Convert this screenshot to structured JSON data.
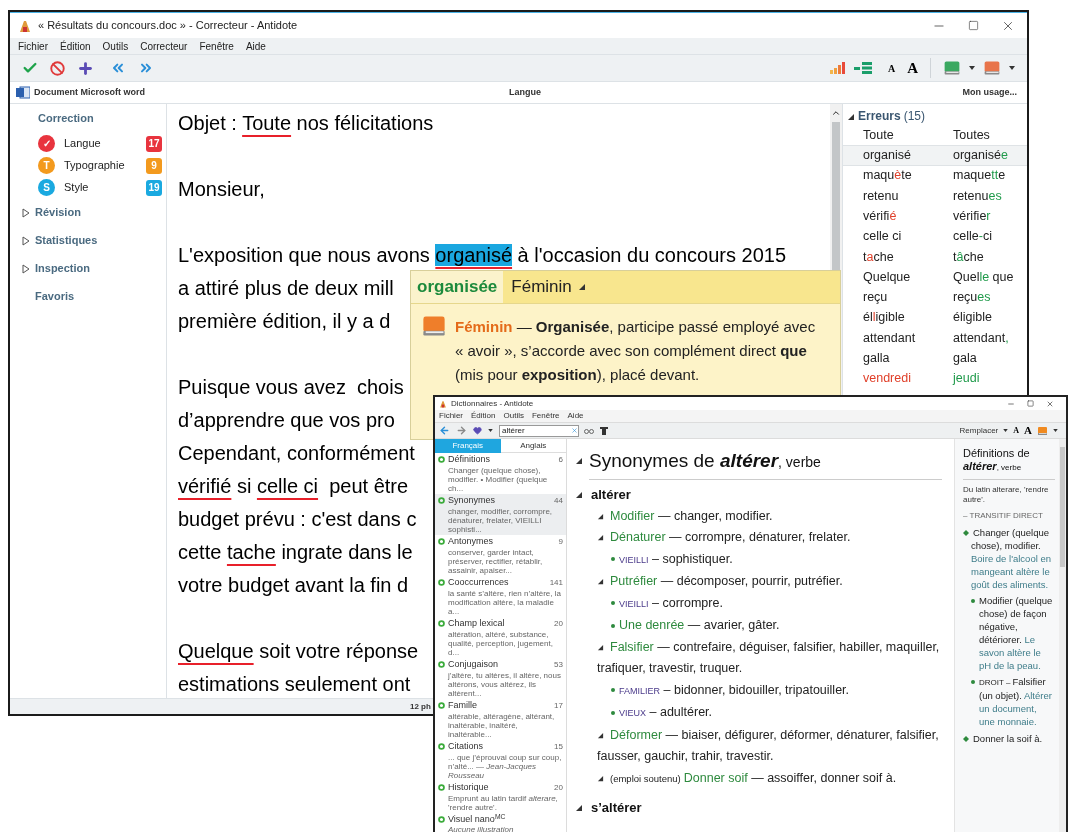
{
  "main_window": {
    "title": "« Résultats du concours.doc » - Correcteur - Antidote",
    "menu": [
      "Fichier",
      "Édition",
      "Outils",
      "Correcteur",
      "Fenêtre",
      "Aide"
    ],
    "toolbar_text": [
      "A",
      "A"
    ],
    "document_bar": {
      "source": "Document Microsoft word",
      "section": "Langue",
      "usage": "Mon usage..."
    },
    "sidebar": {
      "heading": "Correction",
      "filters": [
        {
          "label": "Langue",
          "count": "17",
          "color": "#e8343e",
          "symbol": "✓"
        },
        {
          "label": "Typographie",
          "count": "9",
          "color": "#f39a1e",
          "symbol": "T"
        },
        {
          "label": "Style",
          "count": "19",
          "color": "#1aa9e0",
          "symbol": "S"
        }
      ],
      "sections": [
        {
          "label": "Révision",
          "kind": "collapsible",
          "expanded": false
        },
        {
          "label": "Statistiques",
          "kind": "collapsible",
          "expanded": false
        },
        {
          "label": "Inspection",
          "kind": "collapsible",
          "expanded": false
        },
        {
          "label": "Favoris",
          "kind": "plain"
        }
      ]
    },
    "document": [
      [
        [
          {
            "text": "Objet : "
          },
          {
            "text": "Toute",
            "kind": "error"
          },
          {
            "text": " nos félicitations"
          }
        ]
      ],
      [
        [
          {
            "text": "Monsieur,"
          }
        ]
      ],
      [
        [
          {
            "text": "L'exposition que nous avons "
          },
          {
            "text": "organisé",
            "kind": "selected_error"
          },
          {
            "text": " à l'occasion du concours 2015"
          }
        ],
        [
          {
            "text": "a attiré plus de deux mill"
          }
        ],
        [
          {
            "text": "première édition, il y a d"
          }
        ]
      ],
      [
        [
          {
            "text": "Puisque vous avez  chois"
          }
        ],
        [
          {
            "text": "d’apprendre que vos pro"
          }
        ],
        [
          {
            "text": "Cependant, conformément"
          }
        ],
        [
          {
            "text": "vérifié",
            "kind": "error"
          },
          {
            "text": " si "
          },
          {
            "text": "celle ci",
            "kind": "error"
          },
          {
            "text": "  peut être"
          }
        ],
        [
          {
            "text": "budget prévu : c'est dans c"
          }
        ],
        [
          {
            "text": "cette "
          },
          {
            "text": "tache",
            "kind": "error"
          },
          {
            "text": " ingrate dans le"
          }
        ],
        [
          {
            "text": "votre budget avant la fin d"
          }
        ]
      ],
      [
        [
          {
            "text": "Quelque",
            "kind": "error"
          },
          {
            "text": " soit votre réponse"
          }
        ],
        [
          {
            "text": "estimations seulement ont"
          }
        ]
      ]
    ],
    "errors": {
      "title": "Erreurs",
      "count": "(15)",
      "expanded": true,
      "rows": [
        {
          "selected": false,
          "found": [
            "Toute"
          ],
          "suggestion": [
            "Toutes"
          ]
        },
        {
          "selected": true,
          "found": [
            "organisé"
          ],
          "suggestion": [
            "organisé",
            {
              "text": "e",
              "changed": true
            }
          ]
        },
        {
          "selected": false,
          "found": [
            "maqu",
            {
              "text": "è",
              "changed": true
            },
            "te"
          ],
          "suggestion": [
            "maque",
            {
              "text": "tt",
              "changed": true
            },
            "e"
          ]
        },
        {
          "selected": false,
          "found": [
            "retenu"
          ],
          "suggestion": [
            "retenu",
            {
              "text": "es",
              "changed": true
            }
          ]
        },
        {
          "selected": false,
          "found": [
            "vérifi",
            {
              "text": "é",
              "changed": true
            }
          ],
          "suggestion": [
            "vérifie",
            {
              "text": "r",
              "changed": true
            }
          ]
        },
        {
          "selected": false,
          "found": [
            "celle ci"
          ],
          "suggestion": [
            "celle",
            {
              "text": "-",
              "changed": true
            },
            "ci"
          ]
        },
        {
          "selected": false,
          "found": [
            "t",
            {
              "text": "a",
              "changed": true
            },
            "che"
          ],
          "suggestion": [
            "t",
            {
              "text": "â",
              "changed": true
            },
            "che"
          ]
        },
        {
          "selected": false,
          "found": [
            "Quelque"
          ],
          "suggestion": [
            "Quel",
            {
              "text": "le",
              "changed": true
            },
            " que"
          ]
        },
        {
          "selected": false,
          "found": [
            "reçu"
          ],
          "suggestion": [
            "reçu",
            {
              "text": "es",
              "changed": true
            }
          ]
        },
        {
          "selected": false,
          "found": [
            "él",
            {
              "text": "l",
              "changed": true
            },
            "igible"
          ],
          "suggestion": [
            "éligible"
          ]
        },
        {
          "selected": false,
          "found": [
            "attendant"
          ],
          "suggestion": [
            "attendant",
            {
              "text": ",",
              "changed": true
            }
          ]
        },
        {
          "selected": false,
          "found": [
            "galla"
          ],
          "suggestion": [
            "gala"
          ]
        },
        {
          "selected": false,
          "found": [
            {
              "text": "vendredi",
              "changed": true
            }
          ],
          "suggestion": [
            {
              "text": "jeudi",
              "changed": true
            }
          ]
        }
      ]
    },
    "status": "12 ph"
  },
  "popup": {
    "word": "organisée",
    "category": "Féminin",
    "label": "Féminin",
    "explanation": "— **Organisée**, participe passé employé avec « avoir », s’accorde avec son complément direct **que** (mis pour **exposition**), placé devant."
  },
  "dictionary_window": {
    "title": "Dictionnaires - Antidote",
    "menu": [
      "Fichier",
      "Édition",
      "Outils",
      "Fenêtre",
      "Aide"
    ],
    "search": {
      "value": "altérer"
    },
    "replace": "Remplacer",
    "toolbar_text": [
      "A",
      "A"
    ],
    "tabs": [
      {
        "label": "Français",
        "selected": true
      },
      {
        "label": "Anglais",
        "selected": false
      }
    ],
    "resources": [
      {
        "name": "Définitions",
        "count": "6",
        "summary": "Changer (quelque chose), modifier. • Modifier (quelque ch...",
        "selected": false,
        "kind": "entry"
      },
      {
        "name": "Synonymes",
        "count": "44",
        "summary": "changer, modifier, corrompre, dénaturer, frelater, VIEILLI sophisti...",
        "selected": true,
        "kind": "entry"
      },
      {
        "name": "Antonymes",
        "count": "9",
        "summary": "conserver, garder intact, préserver, rectifier, rétablir, assainir, apaiser...",
        "selected": false,
        "kind": "entry"
      },
      {
        "name": "Cooccurrences",
        "count": "141",
        "summary": "la santé s’altère, rien n’altère, la modification altère, la maladie a...",
        "selected": false,
        "kind": "entry"
      },
      {
        "name": "Champ lexical",
        "count": "20",
        "summary": "altération, altéré, substance, qualité, perception, jugement, d...",
        "selected": false,
        "kind": "entry"
      },
      {
        "name": "Conjugaison",
        "count": "53",
        "summary": "j’altère, tu altères, il altère, nous altérons, vous altérez, ils altèrent...",
        "selected": false,
        "kind": "entry"
      },
      {
        "name": "Famille",
        "count": "17",
        "summary": "altérable, altéragène, altérant, inaltérable, inaltéré, inaltérable...",
        "selected": false,
        "kind": "entry"
      },
      {
        "name": "Citations",
        "count": "15",
        "summary": "... que j’éprouvai coup sur coup, n’alté... — *Jean-Jacques Rousseau*",
        "selected": false,
        "kind": "entry"
      },
      {
        "name": "Historique",
        "count": "20",
        "summary": "Emprunt au latin tardif *alterare*, 'rendre autre'.",
        "selected": false,
        "kind": "entry"
      },
      {
        "name": "Visuel nano$^{MC}$",
        "summary": "Aucune illustration",
        "selected": false,
        "kind": "empty"
      }
    ],
    "synonyms": {
      "prefix": "Synonymes de",
      "word": "altérer",
      "suffix": ", verbe",
      "groups": [
        {
          "title": "altérer",
          "senses": [
            {
              "kind": "sense",
              "label": "Modifier",
              "synonyms": "— changer, modifier."
            },
            {
              "kind": "sense",
              "label": "Dénaturer",
              "synonyms": "— corrompre, dénaturer, frelater."
            },
            {
              "kind": "register",
              "register": "VIEILLI",
              "synonyms": "– sophistiquer."
            },
            {
              "kind": "sense",
              "label": "Putréfier",
              "synonyms": "— décomposer, pourrir, putréfier."
            },
            {
              "kind": "register",
              "register": "VIEILLI",
              "synonyms": "– corrompre."
            },
            {
              "kind": "subsense",
              "label": "Une denrée",
              "synonyms": "— avarier, gâter."
            },
            {
              "kind": "sense",
              "label": "Falsifier",
              "synonyms": "— contrefaire, déguiser, falsifier, habiller, maquiller, trafiquer, travestir, truquer."
            },
            {
              "kind": "register",
              "register": "FAMILIER",
              "synonyms": "– bidonner, bidouiller, tripatouiller."
            },
            {
              "kind": "register",
              "register": "VIEUX",
              "synonyms": "– adultérer."
            },
            {
              "kind": "sense",
              "label": "Déformer",
              "synonyms": "— biaiser, défigurer, déformer, dénaturer, falsifier, fausser, gauchir, trahir, travestir."
            },
            {
              "kind": "sense",
              "qualifier": "(emploi soutenu)",
              "label": "Donner soif",
              "synonyms": "— assoiffer, donner soif à."
            }
          ]
        },
        {
          "title": "s’altérer"
        }
      ]
    },
    "definitions": {
      "prefix": "Définitions de",
      "word": "altérer",
      "suffix": ", verbe",
      "etymology": "Du latin alterare, 'rendre autre'.",
      "category": "– TRANSITIF DIRECT",
      "items": [
        {
          "text": "Changer (quelque chose), modifier.",
          "example": "Boire de l'alcool en mangeant altère le goût des aliments.",
          "children": [
            {
              "text": "Modifier (quelque chose) de façon négative, détériorer.",
              "example": "Le savon altère le pH de la peau."
            },
            {
              "register": "DROIT –",
              "text": "Falsifier (un objet).",
              "example": "Altérer un document, une monnaie."
            }
          ]
        },
        {
          "text": "Donner la soif à."
        }
      ]
    }
  }
}
